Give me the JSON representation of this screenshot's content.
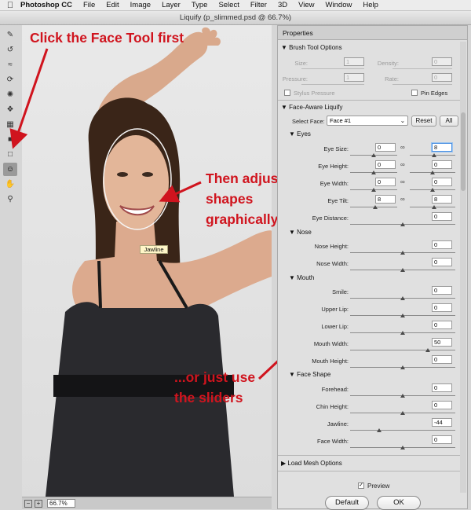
{
  "menubar": {
    "app": "Photoshop CC",
    "items": [
      "File",
      "Edit",
      "Image",
      "Layer",
      "Type",
      "Select",
      "Filter",
      "3D",
      "View",
      "Window",
      "Help"
    ]
  },
  "window": {
    "title": "Liquify (p_slimmed.psd @ 66.7%)"
  },
  "annotations": {
    "click_face_tool": "Click the Face Tool first",
    "adjust_line1": "Then adjust",
    "adjust_line2": "shapes",
    "adjust_line3": "graphically...",
    "sliders_line1": "...or just use",
    "sliders_line2": "the sliders",
    "color": "#d0141e"
  },
  "canvas": {
    "jawline_tooltip": "Jawline"
  },
  "statusbar": {
    "zoom": "66.7%"
  },
  "panel": {
    "tab": "Properties",
    "brush": {
      "title": "Brush Tool Options",
      "size_label": "Size:",
      "size_value": "1",
      "density_label": "Density:",
      "density_value": "0",
      "pressure_label": "Pressure:",
      "pressure_value": "1",
      "rate_label": "Rate:",
      "rate_value": "0",
      "stylus_label": "Stylus Pressure",
      "pin_label": "Pin Edges"
    },
    "face": {
      "title": "Face-Aware Liquify",
      "select_label": "Select Face:",
      "select_value": "Face #1",
      "reset_label": "Reset",
      "all_label": "All"
    },
    "eyes": {
      "title": "Eyes",
      "size_label": "Eye Size:",
      "size_left": "0",
      "size_right": "8",
      "height_label": "Eye Height:",
      "height_left": "0",
      "height_right": "0",
      "width_label": "Eye Width:",
      "width_left": "0",
      "width_right": "0",
      "tilt_label": "Eye Tilt:",
      "tilt_left": "8",
      "tilt_right": "8",
      "distance_label": "Eye Distance:",
      "distance_value": "0"
    },
    "nose": {
      "title": "Nose",
      "height_label": "Nose Height:",
      "height_value": "0",
      "width_label": "Nose Width:",
      "width_value": "0"
    },
    "mouth": {
      "title": "Mouth",
      "smile_label": "Smile:",
      "smile_value": "0",
      "upper_label": "Upper Lip:",
      "upper_value": "0",
      "lower_label": "Lower Lip:",
      "lower_value": "0",
      "width_label": "Mouth Width:",
      "width_value": "50",
      "height_label": "Mouth Height:",
      "height_value": "0"
    },
    "face_shape": {
      "title": "Face Shape",
      "forehead_label": "Forehead:",
      "forehead_value": "0",
      "chin_label": "Chin Height:",
      "chin_value": "0",
      "jawline_label": "Jawline:",
      "jawline_value": "-44",
      "width_label": "Face Width:",
      "width_value": "0"
    },
    "load_mesh": {
      "title": "Load Mesh Options"
    },
    "preview_label": "Preview",
    "default_label": "Default",
    "ok_label": "OK"
  }
}
